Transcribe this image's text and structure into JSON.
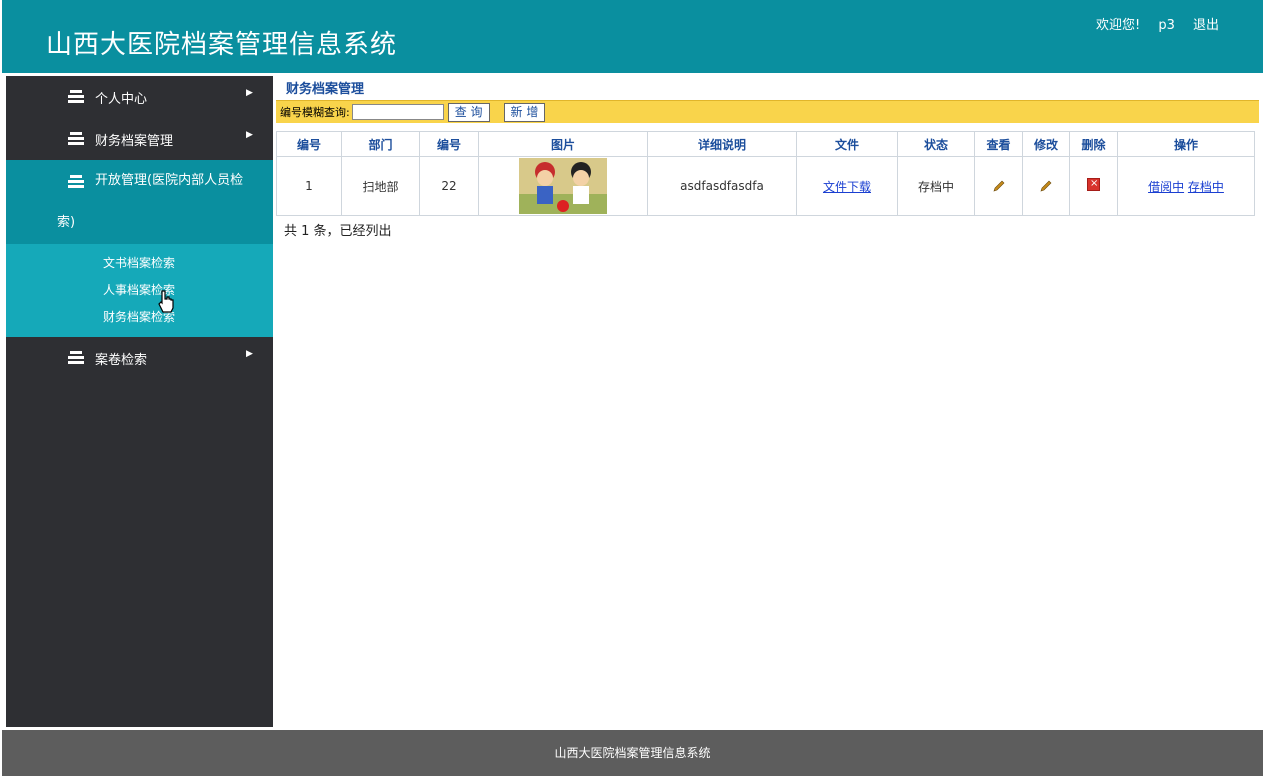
{
  "header": {
    "app_title": "山西大医院档案管理信息系统",
    "welcome": "欢迎您!",
    "username": "p3",
    "logout": "退出"
  },
  "sidebar": {
    "items": [
      {
        "label": "个人中心",
        "icon": "stack-icon"
      },
      {
        "label": "财务档案管理",
        "icon": "stack-icon"
      },
      {
        "label": "开放管理(医院内部人员检",
        "label_cont": "索)",
        "icon": "stack-icon"
      },
      {
        "label": "案卷检索",
        "icon": "stack-icon"
      }
    ],
    "submenu": [
      "文书档案检索",
      "人事档案检索",
      "财务档案检索"
    ]
  },
  "main": {
    "title": "财务档案管理",
    "search_label": "编号模糊查询:",
    "search_value": "",
    "search_button": "查 询",
    "add_button": "新 增",
    "columns": [
      "编号",
      "部门",
      "编号",
      "图片",
      "详细说明",
      "文件",
      "状态",
      "查看",
      "修改",
      "删除",
      "操作"
    ],
    "rows": [
      {
        "id": "1",
        "dept": "扫地部",
        "code": "22",
        "desc": "asdfasdfasdfa",
        "file": "文件下载",
        "status": "存档中",
        "op1": "借阅中",
        "op2": "存档中"
      }
    ],
    "count_text": "共 1 条，已经列出"
  },
  "footer": {
    "text": "山西大医院档案管理信息系统"
  },
  "colors": {
    "header_bg": "#0a8f9f",
    "sidebar_bg": "#2e2f33",
    "submenu_bg": "#15a9b9",
    "search_bar_bg": "#f9d44b",
    "footer_bg": "#5d5d5d"
  }
}
